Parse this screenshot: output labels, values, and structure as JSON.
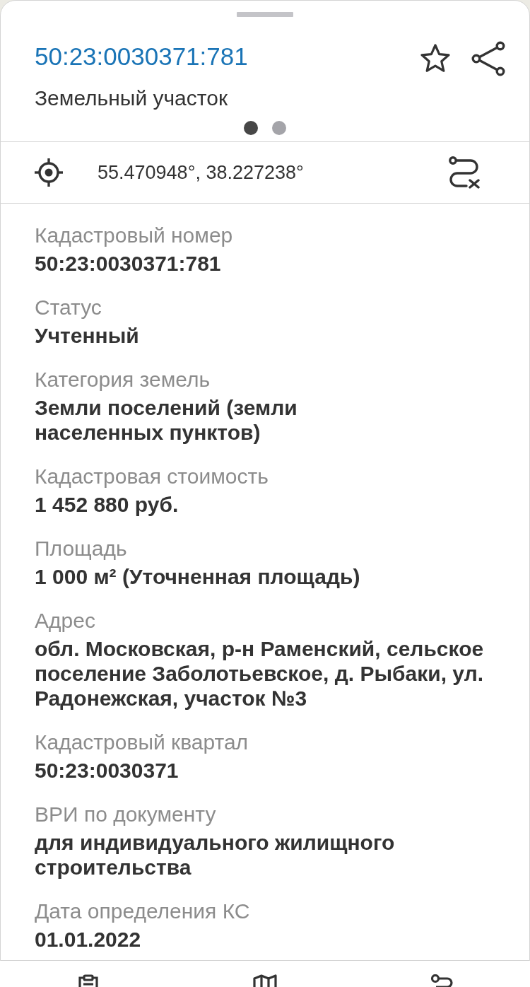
{
  "header": {
    "title": "50:23:0030371:781",
    "subtitle": "Земельный участок",
    "starred": false
  },
  "pager": [
    {
      "selected": true
    },
    {
      "selected": false
    }
  ],
  "coordinates": "55.470948°, 38.227238°",
  "fields": [
    {
      "label": "Кадастровый номер",
      "value": "50:23:0030371:781"
    },
    {
      "label": "Статус",
      "value": "Учтенный"
    },
    {
      "label": "Категория земель",
      "value": "Земли поселений (земли населенных пунктов)"
    },
    {
      "label": "Кадастровая стоимость",
      "value": "1 452 880 руб."
    },
    {
      "label": "Площадь",
      "value": "1 000 м² (Уточненная площадь)"
    },
    {
      "label": "Адрес",
      "value": "обл. Московская, р-н Раменский, сельское поселение Заболотьевское, д. Рыбаки, ул. Радонежская, участок №3"
    },
    {
      "label": "Кадастровый квартал",
      "value": "50:23:0030371"
    },
    {
      "label": "ВРИ по документу",
      "value": "для индивидуального жилищного строительства"
    },
    {
      "label": "Дата определения КС",
      "value": "01.01.2022"
    }
  ]
}
